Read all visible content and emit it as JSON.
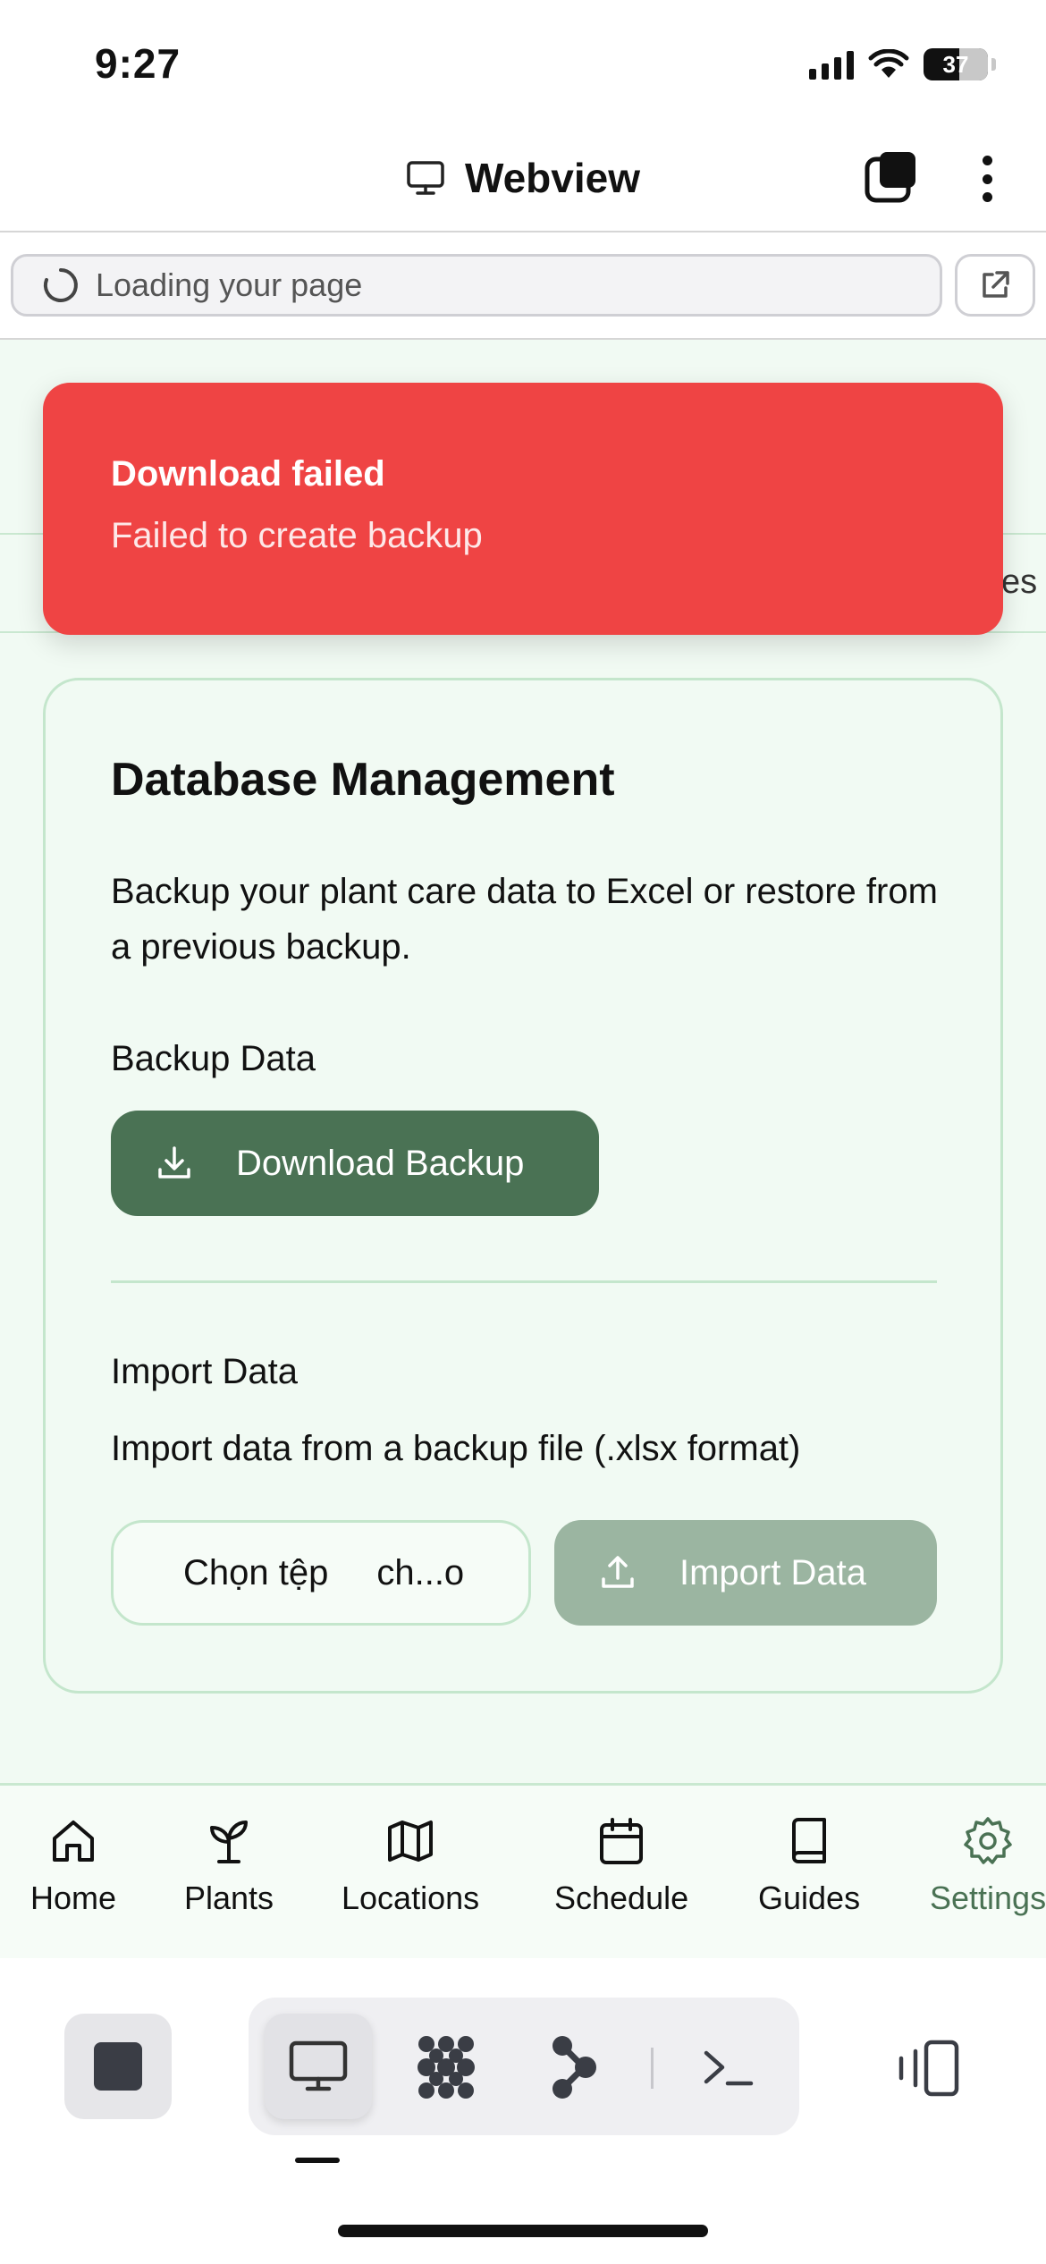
{
  "status": {
    "time": "9:27",
    "battery": "37"
  },
  "header": {
    "title": "Webview"
  },
  "url_bar": {
    "text": "Loading your page"
  },
  "page": {
    "partial_tab_text": "es"
  },
  "toast": {
    "title": "Download failed",
    "description": "Failed to create backup",
    "color": "#ef4444"
  },
  "card": {
    "title": "Database Management",
    "description": "Backup your plant care data to Excel or restore from a previous backup.",
    "backup_label": "Backup Data",
    "download_button": "Download Backup",
    "import_label": "Import Data",
    "import_description": "Import data from a backup file (.xlsx format)",
    "file_choose_label": "Chọn tệp",
    "file_name": "ch...o",
    "import_button": "Import Data"
  },
  "nav": {
    "items": [
      {
        "label": "Home",
        "icon": "home-icon"
      },
      {
        "label": "Plants",
        "icon": "sprout-icon"
      },
      {
        "label": "Locations",
        "icon": "map-icon"
      },
      {
        "label": "Schedule",
        "icon": "calendar-icon"
      },
      {
        "label": "Guides",
        "icon": "book-icon"
      },
      {
        "label": "Settings",
        "icon": "gear-icon",
        "active": true
      }
    ],
    "accent": "#4a7254"
  }
}
